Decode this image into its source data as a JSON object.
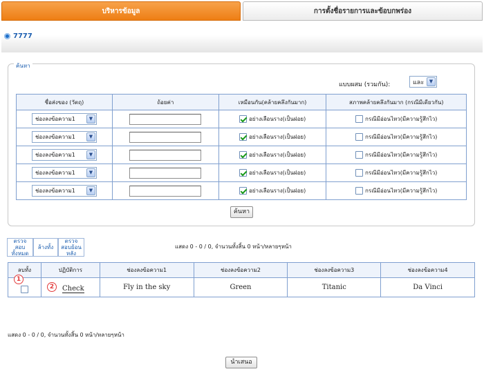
{
  "tabs": [
    {
      "label": "บริหารข้อมูล",
      "active": true
    },
    {
      "label": "การตั้งชื่อรายการและข้อบกพร่อง",
      "active": false
    }
  ],
  "header": {
    "code": "7777",
    "bullet_icon": "blue-circle-bullet-icon"
  },
  "search": {
    "legend": "ค้นหา",
    "mix_label": "แบบผสม (รวมกัน):",
    "mix_value": "และ",
    "columns": [
      "ชื่อส่งของ (วัตถุ)",
      "ถ้อยค่า",
      "เหมือนกัน(คล้ายคลึงกันมาก)",
      "สภาพคล้ายคลึงกันมาก (กรณีมีเดียวกัน)"
    ],
    "rows": [
      {
        "field": "ช่องลงข้อความ1",
        "value": "",
        "similar": true,
        "similar_label": "อย่างเลือนราง(เป็นฝอย)",
        "sensitive": false,
        "sensitive_label": "กรณีมีอ่อนไหว(มีความรู้สึกไว)"
      },
      {
        "field": "ช่องลงข้อความ1",
        "value": "",
        "similar": true,
        "similar_label": "อย่างเลือนราง(เป็นฝอย)",
        "sensitive": false,
        "sensitive_label": "กรณีมีอ่อนไหว(มีความรู้สึกไว)"
      },
      {
        "field": "ช่องลงข้อความ1",
        "value": "",
        "similar": true,
        "similar_label": "อย่างเลือนราง(เป็นฝอย)",
        "sensitive": false,
        "sensitive_label": "กรณีมีอ่อนไหว(มีความรู้สึกไว)"
      },
      {
        "field": "ช่องลงข้อความ1",
        "value": "",
        "similar": true,
        "similar_label": "อย่างเลือนราง(เป็นฝอย)",
        "sensitive": false,
        "sensitive_label": "กรณีมีอ่อนไหว(มีความรู้สึกไว)"
      },
      {
        "field": "ช่องลงข้อความ1",
        "value": "",
        "similar": true,
        "similar_label": "อย่างเลือนราง(เป็นฝอย)",
        "sensitive": false,
        "sensitive_label": "กรณีมีอ่อนไหว(มีความรู้สึกไว)"
      }
    ],
    "search_button": "ค้นหา"
  },
  "actions": {
    "check_all": "ตรวจสอบทั้งหมด",
    "clear_all": "ล้างทั้ง",
    "check_back": "ตรวจสอบย้อนหลัง"
  },
  "info_top": "แสดง 0 - 0 / 0, จำนวนทั้งสิ้น 0 หน้า/หลายๆหน้า",
  "results": {
    "columns": [
      "ลบทั้ง",
      "ปฏิบัติการ",
      "ช่องลงข้อความ1",
      "ช่องลงข้อความ2",
      "ช่องลงข้อความ3",
      "ช่องลงข้อความ4"
    ],
    "row": {
      "operation": "Check",
      "c1": "Fly in the sky",
      "c2": "Green",
      "c3": "Titanic",
      "c4": "Da Vinci"
    },
    "markers": [
      "1",
      "2"
    ]
  },
  "info_bottom": "แสดง 0 - 0 / 0, จำนวนทั้งสิ้น 0 หน้า/หลายๆหน้า",
  "submit_button": "นำเสนอ"
}
